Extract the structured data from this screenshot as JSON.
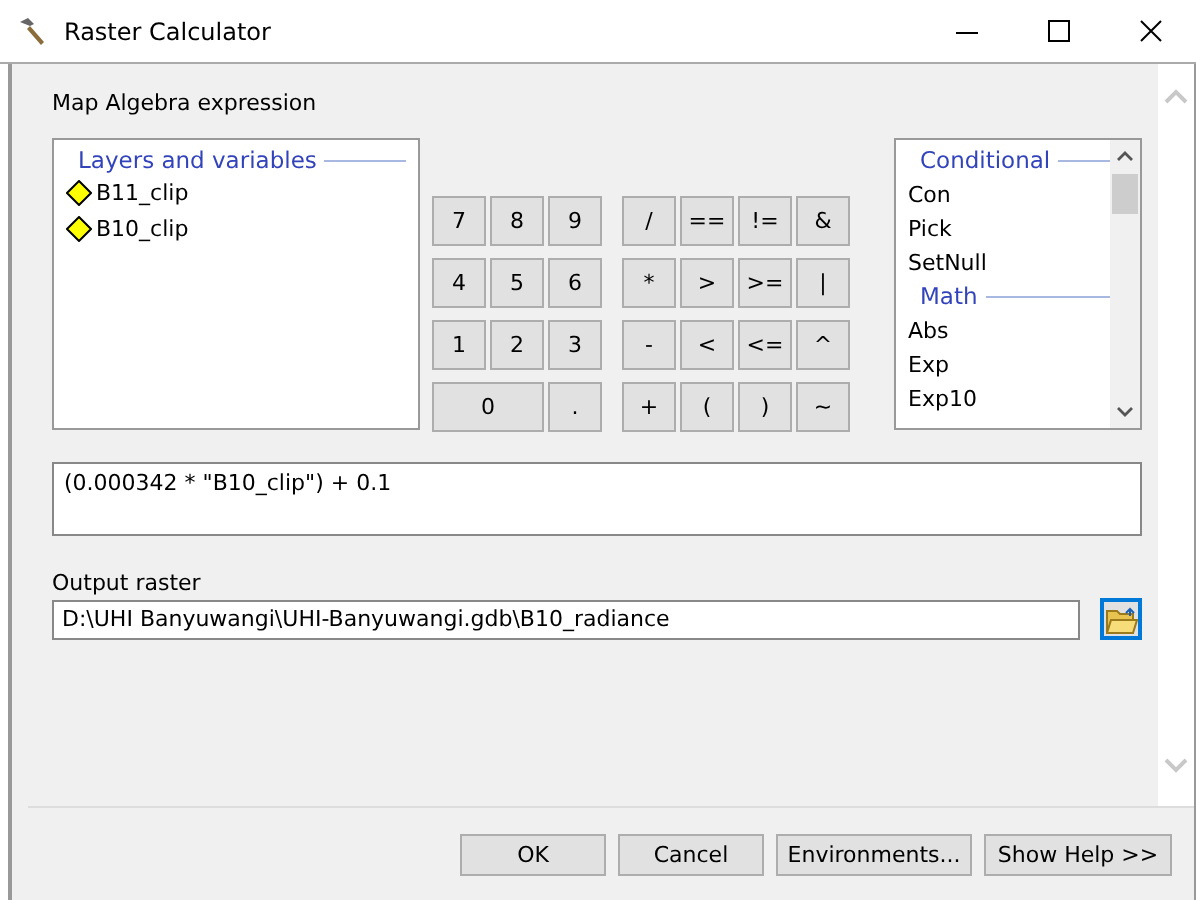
{
  "window": {
    "title": "Raster Calculator"
  },
  "expression_label": "Map Algebra expression",
  "layers": {
    "title": "Layers and variables",
    "items": [
      "B11_clip",
      "B10_clip"
    ]
  },
  "keypad": {
    "digits": [
      {
        "label": "7",
        "kind": "key"
      },
      {
        "label": "8",
        "kind": "key"
      },
      {
        "label": "9",
        "kind": "key"
      },
      {
        "label": "4",
        "kind": "key"
      },
      {
        "label": "5",
        "kind": "key"
      },
      {
        "label": "6",
        "kind": "key"
      },
      {
        "label": "1",
        "kind": "key"
      },
      {
        "label": "2",
        "kind": "key"
      },
      {
        "label": "3",
        "kind": "key"
      },
      {
        "label": "0",
        "kind": "wide"
      },
      {
        "label": ".",
        "kind": "key"
      }
    ],
    "operators": [
      "/",
      "==",
      "!=",
      "&",
      "*",
      ">",
      ">=",
      "|",
      "-",
      "<",
      "<=",
      "^",
      "+",
      "(",
      ")",
      "~"
    ]
  },
  "functions": {
    "groups": [
      {
        "title": "Conditional",
        "items": [
          "Con",
          "Pick",
          "SetNull"
        ]
      },
      {
        "title": "Math",
        "items": [
          "Abs",
          "Exp",
          "Exp10"
        ]
      }
    ]
  },
  "expression": "(0.000342 * \"B10_clip\") + 0.1",
  "output": {
    "label": "Output raster",
    "value": "D:\\UHI Banyuwangi\\UHI-Banyuwangi.gdb\\B10_radiance"
  },
  "buttons": [
    "OK",
    "Cancel",
    "Environments...",
    "Show Help >>"
  ]
}
